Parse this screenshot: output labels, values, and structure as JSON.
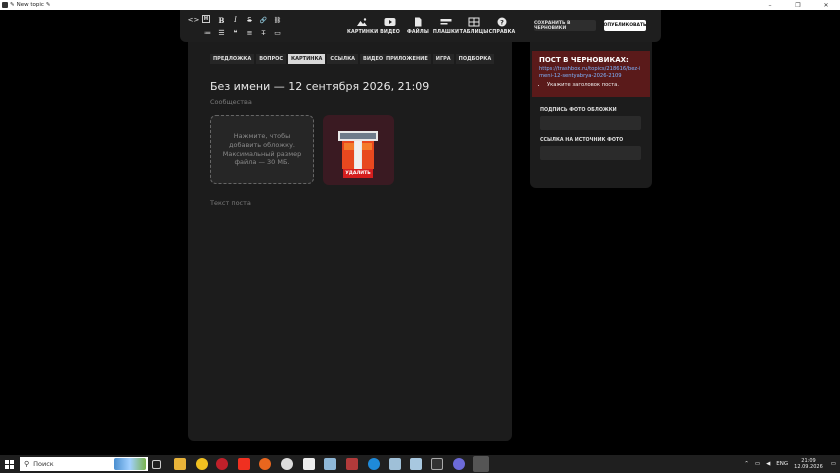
{
  "window": {
    "title": "New topic",
    "controls": [
      "–",
      "❐",
      "✕"
    ]
  },
  "toolbar": {
    "format_icons": [
      {
        "name": "code-icon",
        "glyph": "<>"
      },
      {
        "name": "heading-icon",
        "glyph": "H"
      },
      {
        "name": "bold-icon",
        "glyph": "B"
      },
      {
        "name": "italic-icon",
        "glyph": "I"
      },
      {
        "name": "strikethrough-icon",
        "glyph": "S"
      },
      {
        "name": "link-icon",
        "glyph": "🔗"
      },
      {
        "name": "unlink-icon",
        "glyph": "⛓"
      },
      {
        "name": "bullet-list-icon",
        "glyph": "≔"
      },
      {
        "name": "numbered-list-icon",
        "glyph": "☰"
      },
      {
        "name": "quote-icon",
        "glyph": "❝"
      },
      {
        "name": "align-center-icon",
        "glyph": "≡"
      },
      {
        "name": "clear-format-icon",
        "glyph": "T̶"
      },
      {
        "name": "spoiler-icon",
        "glyph": "▭"
      }
    ],
    "images_label": "КАРТИНКИ",
    "video_label": "ВИДЕО",
    "files_label": "ФАЙЛЫ",
    "plates_label": "ПЛАШКИ",
    "tables_label": "ТАБЛИЦЫ",
    "help_label": "СПРАВКА",
    "save_label": "СОХРАНИТЬ В ЧЕРНОВИКИ",
    "publish_label": "ОПУБЛИКОВАТЬ"
  },
  "main": {
    "tabs_left": [
      {
        "label": "ПРЕДЛОЖКА",
        "active": false
      },
      {
        "label": "ВОПРОС",
        "active": false
      },
      {
        "label": "КАРТИНКА",
        "active": true
      },
      {
        "label": "ССЫЛКА",
        "active": false
      },
      {
        "label": "ВИДЕО",
        "active": false
      }
    ],
    "tabs_right": [
      {
        "label": "ПРИЛОЖЕНИЕ",
        "active": false
      },
      {
        "label": "ИГРА",
        "active": false
      },
      {
        "label": "ПОДБОРКА",
        "active": false
      }
    ],
    "title": "Без имени — 12 сентября 2026, 21:09",
    "communities_placeholder": "Сообщества",
    "cover_hint": "Нажмите, чтобы добавить обложку. Максимальный размер файла — 30 МБ.",
    "delete_label": "УДАЛИТЬ",
    "body_placeholder": "Текст поста",
    "accent_color": "#d51e1e"
  },
  "sidebar": {
    "draft_heading": "ПОСТ В ЧЕРНОВИКАХ:",
    "draft_link": "https://trashbox.ru/topics/218616/bez-imeni-12-sentyabrya-2026-2109",
    "draft_warnings": [
      "Укажите заголовок поста."
    ],
    "cover_caption_label": "ПОДПИСЬ ФОТО ОБЛОЖКИ",
    "photo_source_label": "ССЫЛКА НА ИСТОЧНИК ФОТО"
  },
  "taskbar": {
    "search_label": "Поиск",
    "lang": "ENG",
    "time": "21:09",
    "date": "12.09.2026"
  }
}
